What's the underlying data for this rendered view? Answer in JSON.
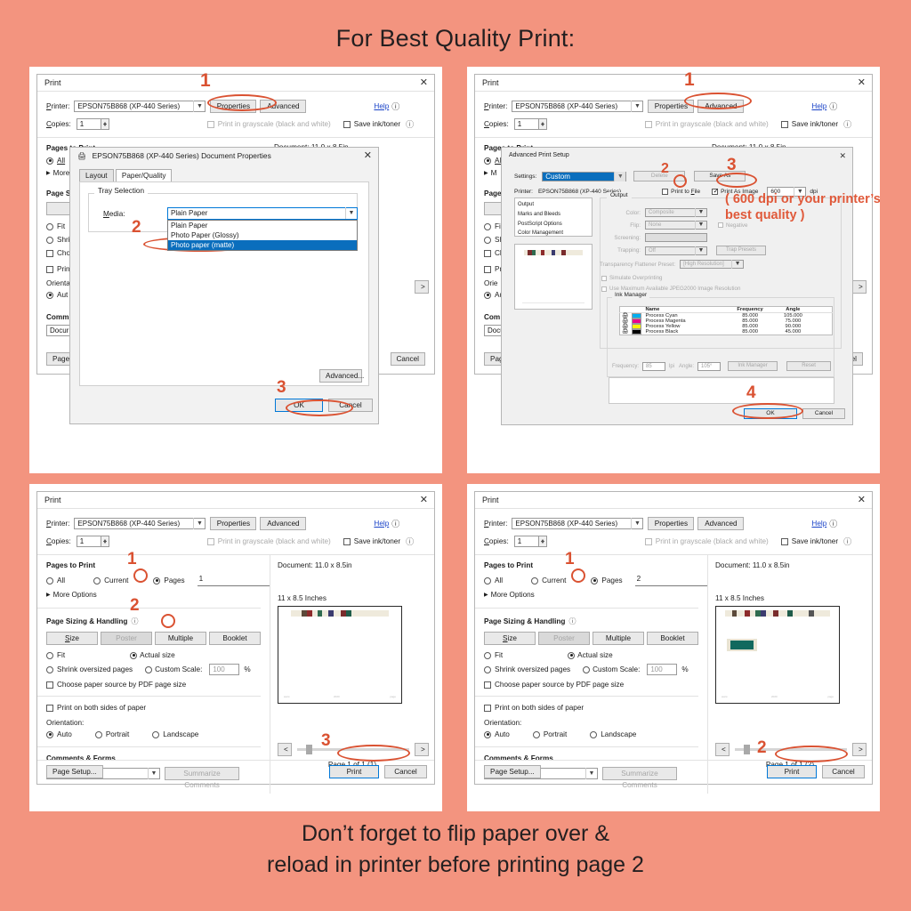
{
  "page": {
    "title": "For Best Quality Print:",
    "footer_line1": "Don’t forget to flip paper over &",
    "footer_line2": "reload in printer before printing page 2",
    "background_color": "#F3947F",
    "accent_color": "#DA5232"
  },
  "common": {
    "print_title": "Print",
    "printer_label": "Printer:",
    "printer_value": "EPSON75B868 (XP-440 Series)",
    "properties_btn": "Properties",
    "advanced_btn": "Advanced",
    "help_link": "Help",
    "copies_label": "Copies:",
    "copies_value": "1",
    "grayscale_label": "Print in grayscale (black and white)",
    "save_ink_label": "Save ink/toner",
    "pages_to_print": "Pages to Print",
    "opt_all": "All",
    "opt_current": "Current",
    "opt_pages": "Pages",
    "more_options": "More Options",
    "document_size": "Document: 11.0 x 8.5in",
    "page_sizing": "Page Sizing & Handling",
    "btn_size": "Size",
    "btn_poster": "Poster",
    "btn_multiple": "Multiple",
    "btn_booklet": "Booklet",
    "opt_fit": "Fit",
    "opt_actual": "Actual size",
    "opt_shrink": "Shrink oversized pages",
    "opt_custom_scale": "Custom Scale:",
    "custom_scale_value": "100",
    "percent": "%",
    "opt_choose_paper": "Choose paper source by PDF page size",
    "opt_both_sides": "Print on both sides of paper",
    "orientation": "Orientation:",
    "opt_auto": "Auto",
    "opt_portrait": "Portrait",
    "opt_landscape": "Landscape",
    "comments_forms": "Comments & Forms",
    "comments_value": "Document",
    "summarize_btn": "Summarize Comments",
    "page_setup_btn": "Page Setup...",
    "print_btn": "Print",
    "cancel_btn": "Cancel",
    "sheet_size": "11 x 8.5 Inches"
  },
  "panel1": {
    "marker1": "1",
    "marker2": "2",
    "marker3": "3",
    "doc_props_title": "EPSON75B868 (XP-440 Series) Document Properties",
    "tab_layout": "Layout",
    "tab_paper_quality": "Paper/Quality",
    "tray_selection": "Tray Selection",
    "media_label": "Media:",
    "media_value": "Plain Paper",
    "media_options": [
      "Plain Paper",
      "Photo Paper (Glossy)",
      "Photo paper (matte)"
    ],
    "media_selected_index": 2,
    "advanced_dots_btn": "Advanced...",
    "ok_btn": "OK",
    "cancel_btn": "Cancel"
  },
  "panel2": {
    "marker1": "1",
    "marker2": "2",
    "marker3": "3",
    "marker4": "4",
    "annotation": "( 600 dpi or your printer’s best quality )",
    "adv_title": "Advanced Print Setup",
    "settings_label": "Settings:",
    "settings_value": "Custom",
    "delete_btn": "Delete",
    "save_as_btn": "Save As",
    "printer_label": "Printer:",
    "printer_value": "EPSON75B868 (XP-440 Series)",
    "print_to_file": "Print to File",
    "print_as_image": "Print As Image",
    "dpi_value": "600",
    "dpi_unit": "dpi",
    "nav_items": [
      "Output",
      "Marks and Bleeds",
      "PostScript Options",
      "Color Management"
    ],
    "output_group": "Output",
    "color_label": "Color:",
    "color_value": "Composite",
    "flip_label": "Flip:",
    "flip_value": "None",
    "negative_label": "Negative",
    "screening_label": "Screening:",
    "screening_value": "",
    "trapping_label": "Trapping:",
    "trapping_value": "Off",
    "trap_presets_btn": "Trap Presets",
    "flattener_label": "Transparency Flattener Preset:",
    "flattener_value": "[High Resolution]",
    "simulate_overprint": "Simulate Overprinting",
    "max_jpeg": "Use Maximum Available JPEG2000 Image Resolution",
    "ink_manager_group": "Ink Manager",
    "ink_columns": [
      "Name",
      "Frequency",
      "Angle"
    ],
    "ink_rows": [
      {
        "name": "Process Cyan",
        "frequency": "85.000",
        "angle": "105.000",
        "color": "#00AEEF"
      },
      {
        "name": "Process Magenta",
        "frequency": "85.000",
        "angle": "75.000",
        "color": "#EC008C"
      },
      {
        "name": "Process Yellow",
        "frequency": "85.000",
        "angle": "90.000",
        "color": "#FFF200"
      },
      {
        "name": "Process Black",
        "frequency": "85.000",
        "angle": "45.000",
        "color": "#000000"
      }
    ],
    "frequency_label": "Frequency:",
    "frequency_value": "85",
    "lpi_label": "lpi",
    "angle_label": "Angle:",
    "angle_value": "105°",
    "ink_manager_btn": "Ink Manager",
    "reset_btn": "Reset",
    "ok_btn": "OK",
    "cancel_btn": "Cancel"
  },
  "panel3": {
    "marker1": "1",
    "marker2": "2",
    "marker3": "3",
    "pages_value": "1",
    "page_counter": "Page 1 of 1 (1)",
    "nav_prev": "<",
    "nav_next": ">"
  },
  "panel4": {
    "marker1": "1",
    "marker2": "2",
    "pages_value": "2",
    "page_counter": "Page 1 of 1 (2)",
    "nav_prev": "<",
    "nav_next": ">"
  }
}
